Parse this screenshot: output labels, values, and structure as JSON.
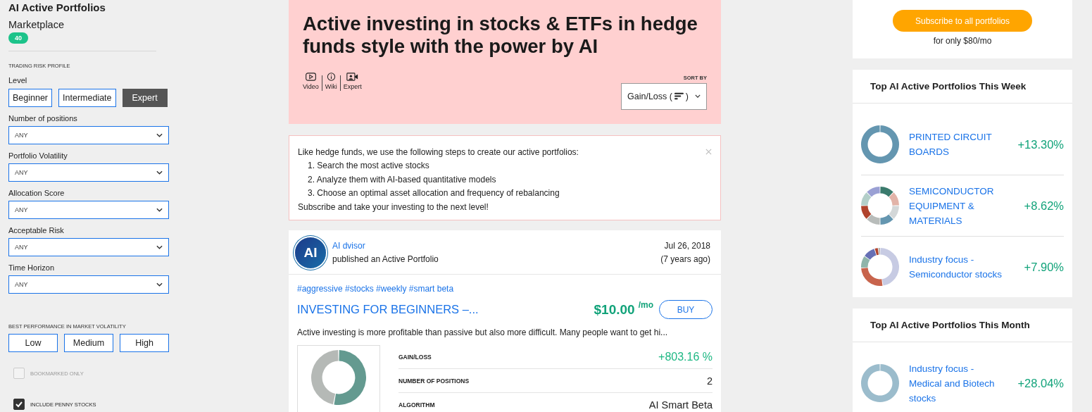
{
  "sidebar": {
    "title": "AI Active Portfolios",
    "subtitle": "Marketplace",
    "count": "40",
    "section_label": "TRADING RISK PROFILE",
    "level_label": "Level",
    "levels": [
      {
        "label": "Beginner",
        "selected": false
      },
      {
        "label": "Intermediate",
        "selected": false
      },
      {
        "label": "Expert",
        "selected": true
      }
    ],
    "filters": [
      {
        "label": "Number of positions",
        "value": "ANY"
      },
      {
        "label": "Portfolio Volatility",
        "value": "ANY"
      },
      {
        "label": "Allocation Score",
        "value": "ANY"
      },
      {
        "label": "Acceptable Risk",
        "value": "ANY"
      },
      {
        "label": "Time Horizon",
        "value": "ANY"
      }
    ],
    "volatility_label": "BEST PERFORMANCE IN MARKET VOLATILITY",
    "volatility": [
      {
        "label": "Low",
        "selected": false
      },
      {
        "label": "Medium",
        "selected": false
      },
      {
        "label": "High",
        "selected": false
      }
    ],
    "checkboxes": [
      {
        "label": "BOOKMARKED ONLY",
        "checked": false
      },
      {
        "label": "INCLUDE PENNY STOCKS",
        "checked": true
      }
    ]
  },
  "hero": {
    "title": "Active investing in stocks & ETFs in hedge funds style with the power by AI",
    "links": [
      {
        "label": "Video",
        "kind": "video"
      },
      {
        "label": "Wiki",
        "kind": "info"
      },
      {
        "label": "Expert",
        "kind": "expert"
      }
    ],
    "sort_label": "SORT BY",
    "sort_value": "Gain/Loss (",
    "sort_close": ")"
  },
  "notice": {
    "intro": "Like hedge funds, we use the following steps to create our active portfolios:",
    "steps": [
      "1. Search the most active stocks",
      "2. Analyze them with AI-based quantitative models",
      "3. Choose an optimal asset allocation and frequency of rebalancing"
    ],
    "outro": "Subscribe and take your investing to the next level!"
  },
  "card": {
    "avatar": "AI",
    "author": "AI dvisor",
    "action": "published an Active Portfolio",
    "date": "Jul 26, 2018",
    "ago": "(7 years ago)",
    "tags": "#aggressive #stocks #weekly #smart beta",
    "title": "INVESTING FOR BEGINNERS –...",
    "price": "$10.00",
    "price_unit": "/mo",
    "buy": "BUY",
    "description": "Active investing is more profitable than passive but also more difficult. Many people want to get hi...",
    "stats": [
      {
        "label": "GAIN/LOSS",
        "value": "+803.16 %",
        "kind": "gain"
      },
      {
        "label": "NUMBER OF POSITIONS",
        "value": "2",
        "kind": "plain"
      },
      {
        "label": "ALGORITHM",
        "value": "AI Smart Beta",
        "kind": "plain"
      }
    ]
  },
  "subscribe": {
    "button": "Subscribe to all portfolios",
    "note": "for only $80/mo"
  },
  "panels": [
    {
      "title": "Top AI Active Portfolios This Week",
      "items": [
        {
          "name": "PRINTED CIRCUIT BOARDS",
          "change": "+13.30%"
        },
        {
          "name": "SEMICONDUCTOR EQUIPMENT & MATERIALS",
          "change": "+8.62%"
        },
        {
          "name": "Industry focus - Semiconductor stocks",
          "change": "+7.90%"
        }
      ]
    },
    {
      "title": "Top AI Active Portfolios This Month",
      "items": [
        {
          "name": "Industry focus - Medical and Biotech stocks",
          "change": "+28.04%"
        }
      ]
    }
  ]
}
